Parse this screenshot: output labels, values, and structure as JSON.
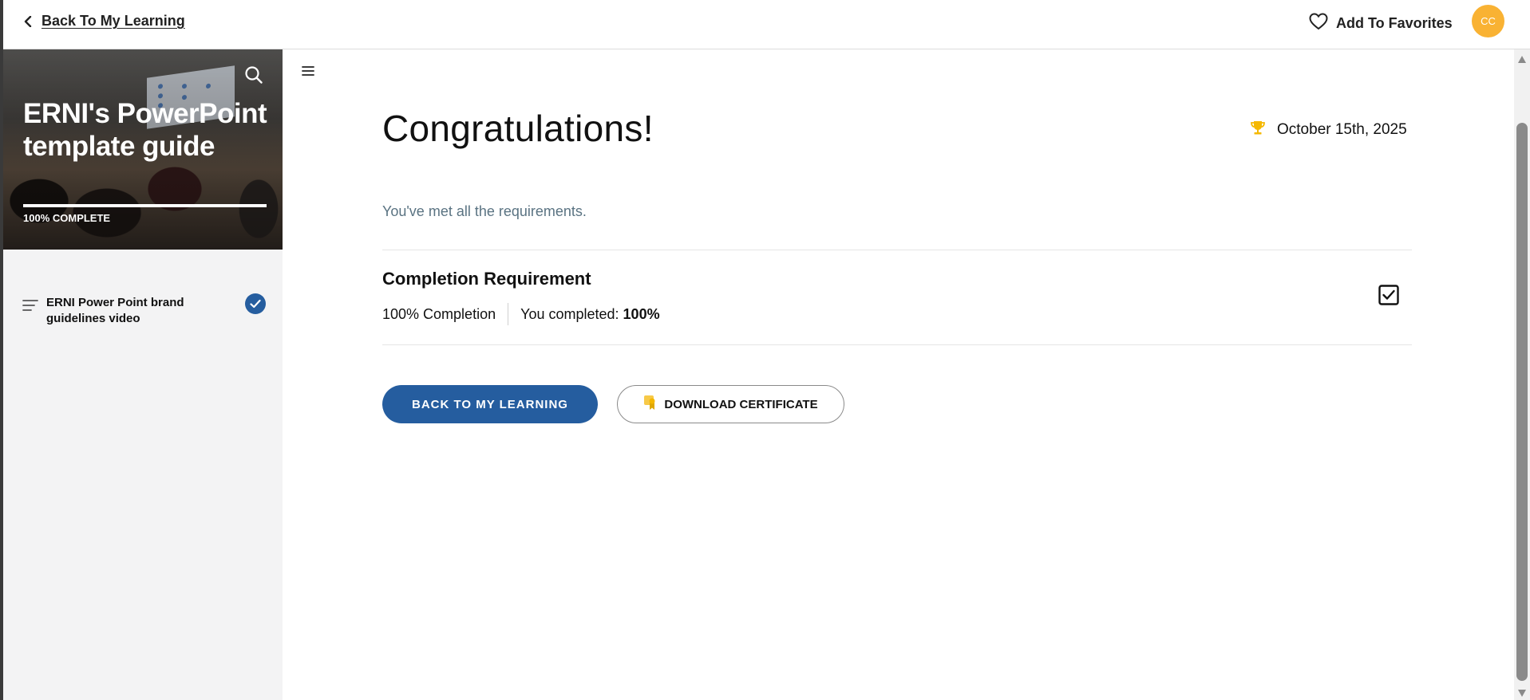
{
  "header": {
    "back_label": "Back To My Learning",
    "favorites_label": "Add To Favorites",
    "avatar_initials": "CC"
  },
  "course": {
    "title": "ERNI's PowerPoint template guide",
    "progress_label": "100% COMPLETE",
    "progress_percent": 100
  },
  "sidebar": {
    "lessons": [
      {
        "label": "ERNI Power Point brand guidelines video",
        "completed": true
      }
    ]
  },
  "main": {
    "heading": "Congratulations!",
    "date": "October 15th, 2025",
    "message": "You've met all the requirements.",
    "requirement": {
      "title": "Completion Requirement",
      "criteria": "100% Completion",
      "completed_prefix": "You completed:",
      "completed_value": "100%",
      "met": true
    },
    "buttons": {
      "back_label": "BACK TO MY LEARNING",
      "certificate_label": "DOWNLOAD CERTIFICATE"
    }
  },
  "colors": {
    "primary": "#255d9f",
    "avatar": "#f9b233",
    "trophy": "#f5b800",
    "muted_text": "#5a7382"
  },
  "icons": [
    "chevron-left-icon",
    "heart-icon",
    "search-icon",
    "menu-lines-icon",
    "check-circle-icon",
    "hamburger-icon",
    "trophy-icon",
    "checkbox-checked-icon",
    "ribbon-certificate-icon"
  ]
}
